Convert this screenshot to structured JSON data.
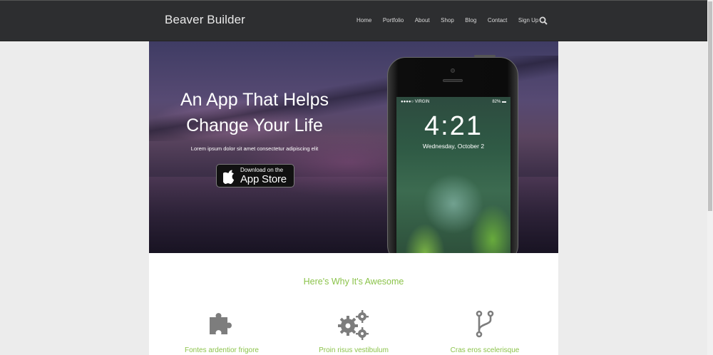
{
  "header": {
    "brand": "Beaver Builder",
    "nav": [
      "Home",
      "Portfolio",
      "About",
      "Shop",
      "Blog",
      "Contact",
      "Sign Up"
    ],
    "search_icon": "search-icon"
  },
  "hero": {
    "title_line1": "An App That Helps",
    "title_line2": "Change Your Life",
    "subtitle": "Lorem ipsum dolor sit amet consectetur adipiscing elit",
    "cta_small": "Download on the",
    "cta_big": "App Store",
    "phone": {
      "carrier": "●●●●○ VIRGIN",
      "battery": "82% ▬",
      "time": "4:21",
      "date": "Wednesday, October 2"
    }
  },
  "features": {
    "heading": "Here's Why It's Awesome",
    "items": [
      {
        "title": "Fontes ardentior frigore",
        "icon": "puzzle-icon"
      },
      {
        "title": "Proin risus vestibulum",
        "icon": "gears-icon"
      },
      {
        "title": "Cras eros scelerisque",
        "icon": "code-fork-icon"
      }
    ]
  },
  "colors": {
    "accent": "#8bc34a",
    "header_bg": "#2d2e30"
  }
}
